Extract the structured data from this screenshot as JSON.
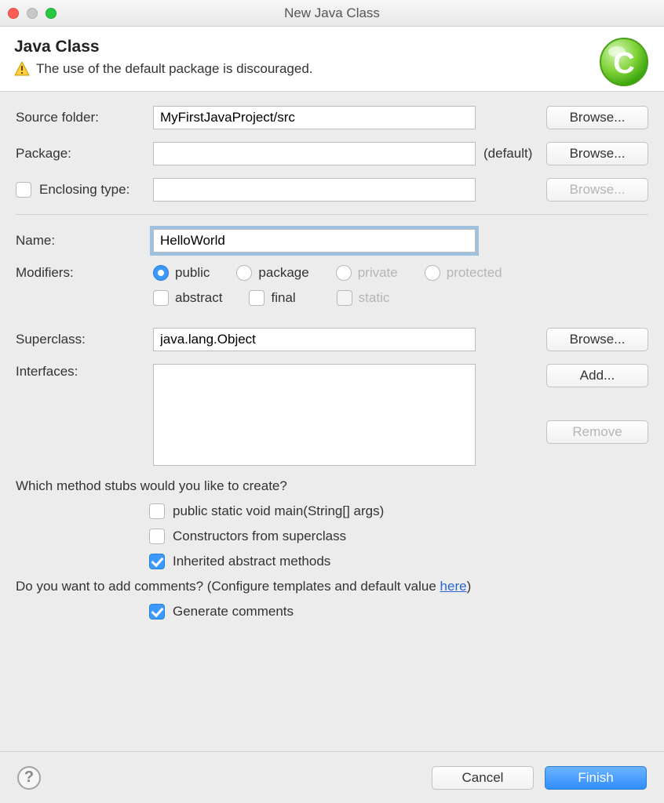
{
  "window": {
    "title": "New Java Class"
  },
  "header": {
    "title": "Java Class",
    "message": "The use of the default package is discouraged."
  },
  "labels": {
    "sourceFolder": "Source folder:",
    "package": "Package:",
    "packageDefault": "(default)",
    "enclosingType": "Enclosing type:",
    "name": "Name:",
    "modifiers": "Modifiers:",
    "superclass": "Superclass:",
    "interfaces": "Interfaces:"
  },
  "values": {
    "sourceFolder": "MyFirstJavaProject/src",
    "package": "",
    "enclosingType": "",
    "name": "HelloWorld",
    "superclass": "java.lang.Object"
  },
  "buttons": {
    "browse": "Browse...",
    "add": "Add...",
    "remove": "Remove",
    "cancel": "Cancel",
    "finish": "Finish"
  },
  "modifiers": {
    "public": "public",
    "packageMod": "package",
    "private": "private",
    "protected": "protected",
    "abstract": "abstract",
    "final": "final",
    "static": "static"
  },
  "stubs": {
    "question": "Which method stubs would you like to create?",
    "main": "public static void main(String[] args)",
    "constructors": "Constructors from superclass",
    "inherited": "Inherited abstract methods"
  },
  "comments": {
    "question_prefix": "Do you want to add comments? (Configure templates and default value ",
    "link": "here",
    "question_suffix": ")",
    "generate": "Generate comments"
  }
}
